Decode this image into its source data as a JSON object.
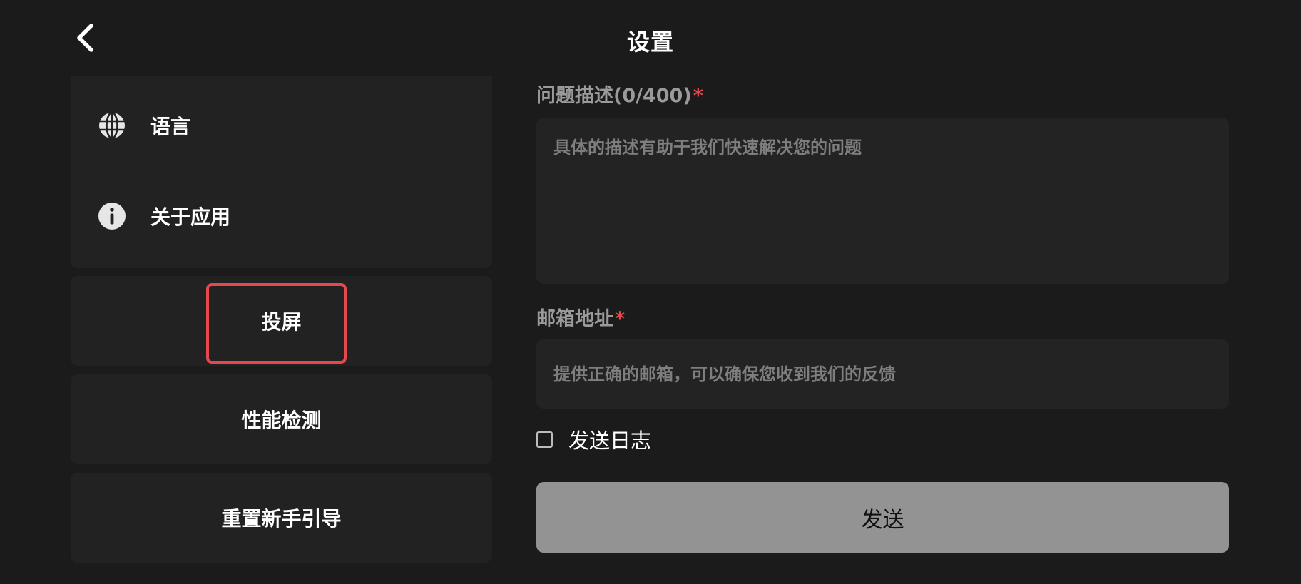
{
  "header": {
    "title": "设置",
    "back_icon": "chevron-left-icon"
  },
  "sidebar": {
    "items": [
      {
        "label": "语言",
        "icon": "globe-icon"
      },
      {
        "label": "关于应用",
        "icon": "info-icon"
      },
      {
        "label": "投屏"
      },
      {
        "label": "性能检测"
      },
      {
        "label": "重置新手引导"
      }
    ],
    "highlight_color": "#e5484d"
  },
  "feedback": {
    "description_label": "问题描述(0/400)",
    "description_placeholder": "具体的描述有助于我们快速解决您的问题",
    "email_label": "邮箱地址",
    "email_placeholder": "提供正确的邮箱，可以确保您收到我们的反馈",
    "required_mark": "*",
    "send_log_label": "发送日志",
    "send_log_checked": false,
    "send_button": "发送"
  }
}
